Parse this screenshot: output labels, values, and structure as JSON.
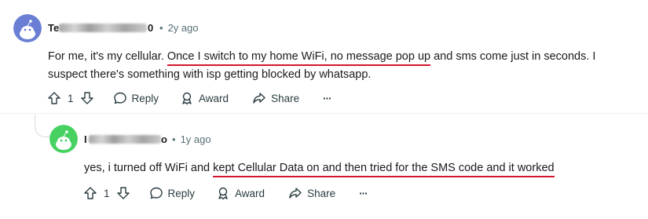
{
  "comments": [
    {
      "username_visible": "Te",
      "username_tail": "0",
      "time": "2y ago",
      "text_before": "For me, it's my cellular. ",
      "text_highlight": "Once I switch to my home WiFi, no message pop up",
      "text_after": " and sms come just in seconds. I suspect there's something with isp getting blocked by whatsapp.",
      "vote_count": "1",
      "reply_label": "Reply",
      "award_label": "Award",
      "share_label": "Share",
      "more_label": "···",
      "avatar_color": "#6a7fd3"
    },
    {
      "username_visible": "I",
      "username_tail": "o",
      "time": "1y ago",
      "text_before": "yes, i turned off WiFi and ",
      "text_highlight": "kept Cellular Data on and then tried for the SMS code and it worked",
      "text_after": "",
      "vote_count": "1",
      "reply_label": "Reply",
      "award_label": "Award",
      "share_label": "Share",
      "more_label": "···",
      "avatar_color": "#46d160"
    }
  ],
  "colors": {
    "highlight_underline": "#d4152d",
    "meta_text": "#576f76"
  }
}
